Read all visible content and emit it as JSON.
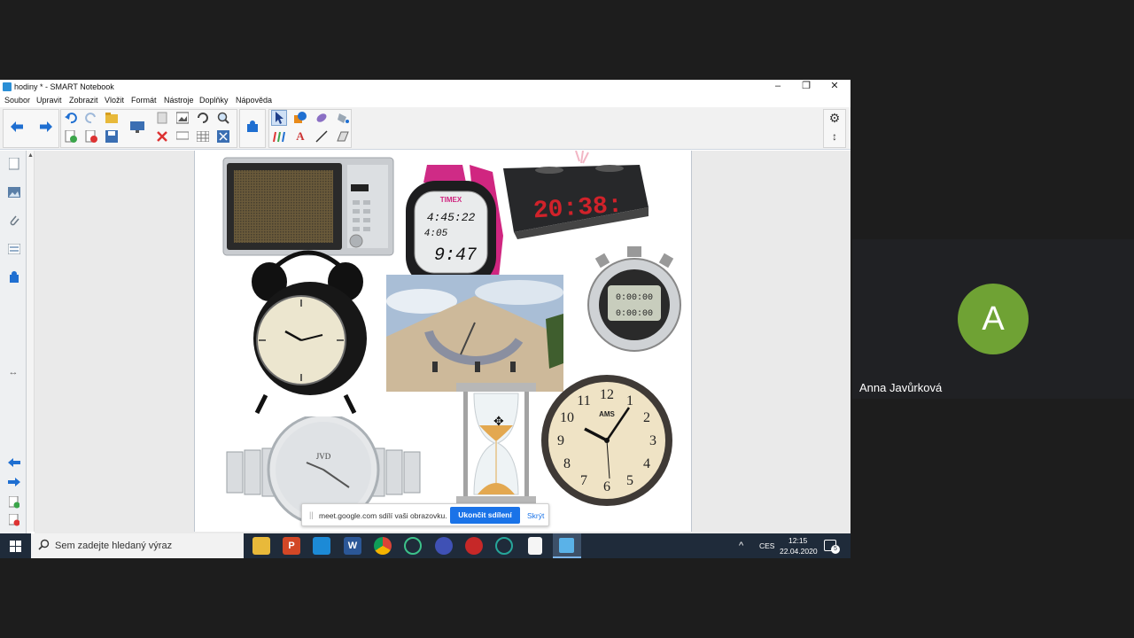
{
  "window": {
    "title": "hodiny * - SMART Notebook",
    "controls": {
      "minimize": "–",
      "restore": "❐",
      "close": "✕"
    }
  },
  "menu": [
    "Soubor",
    "Upravit",
    "Zobrazit",
    "Vložit",
    "Formát",
    "Nástroje",
    "Doplňky",
    "Nápověda"
  ],
  "slide": {
    "clock_readouts": {
      "alarm_display": "20:38:",
      "sportwatch_line1": "4:45:22",
      "sportwatch_line2": "4:05",
      "sportwatch_line3": "9:47",
      "stopwatch_line1": "0:00:00",
      "stopwatch_line2": "0:00:00",
      "wallclock_brand": "AMS",
      "sportwatch_brand": "TIMEX",
      "wristwatch_brand": "JVD",
      "wallclock_numerals": [
        "12",
        "1",
        "2",
        "3",
        "4",
        "5",
        "6",
        "7",
        "8",
        "9",
        "10",
        "11"
      ]
    }
  },
  "share_bar": {
    "message": "meet.google.com sdílí vaši obrazovku.",
    "stop_label": "Ukončit sdílení",
    "hide_label": "Skrýt",
    "grip": "||"
  },
  "taskbar": {
    "search_placeholder": "Sem zadejte hledaný výraz",
    "language": "CES",
    "time": "12:15",
    "date": "22.04.2020",
    "notifications": "5",
    "tray_chevron": "^"
  },
  "participant": {
    "initial": "A",
    "name": "Anna Javůrková",
    "avatar_color": "#6fa234"
  },
  "icons": {
    "back": "arrow-left-icon",
    "forward": "arrow-right-icon",
    "select": "cursor-icon",
    "pen": "pen-icon",
    "eraser": "eraser-icon",
    "settings": "gear-icon"
  }
}
